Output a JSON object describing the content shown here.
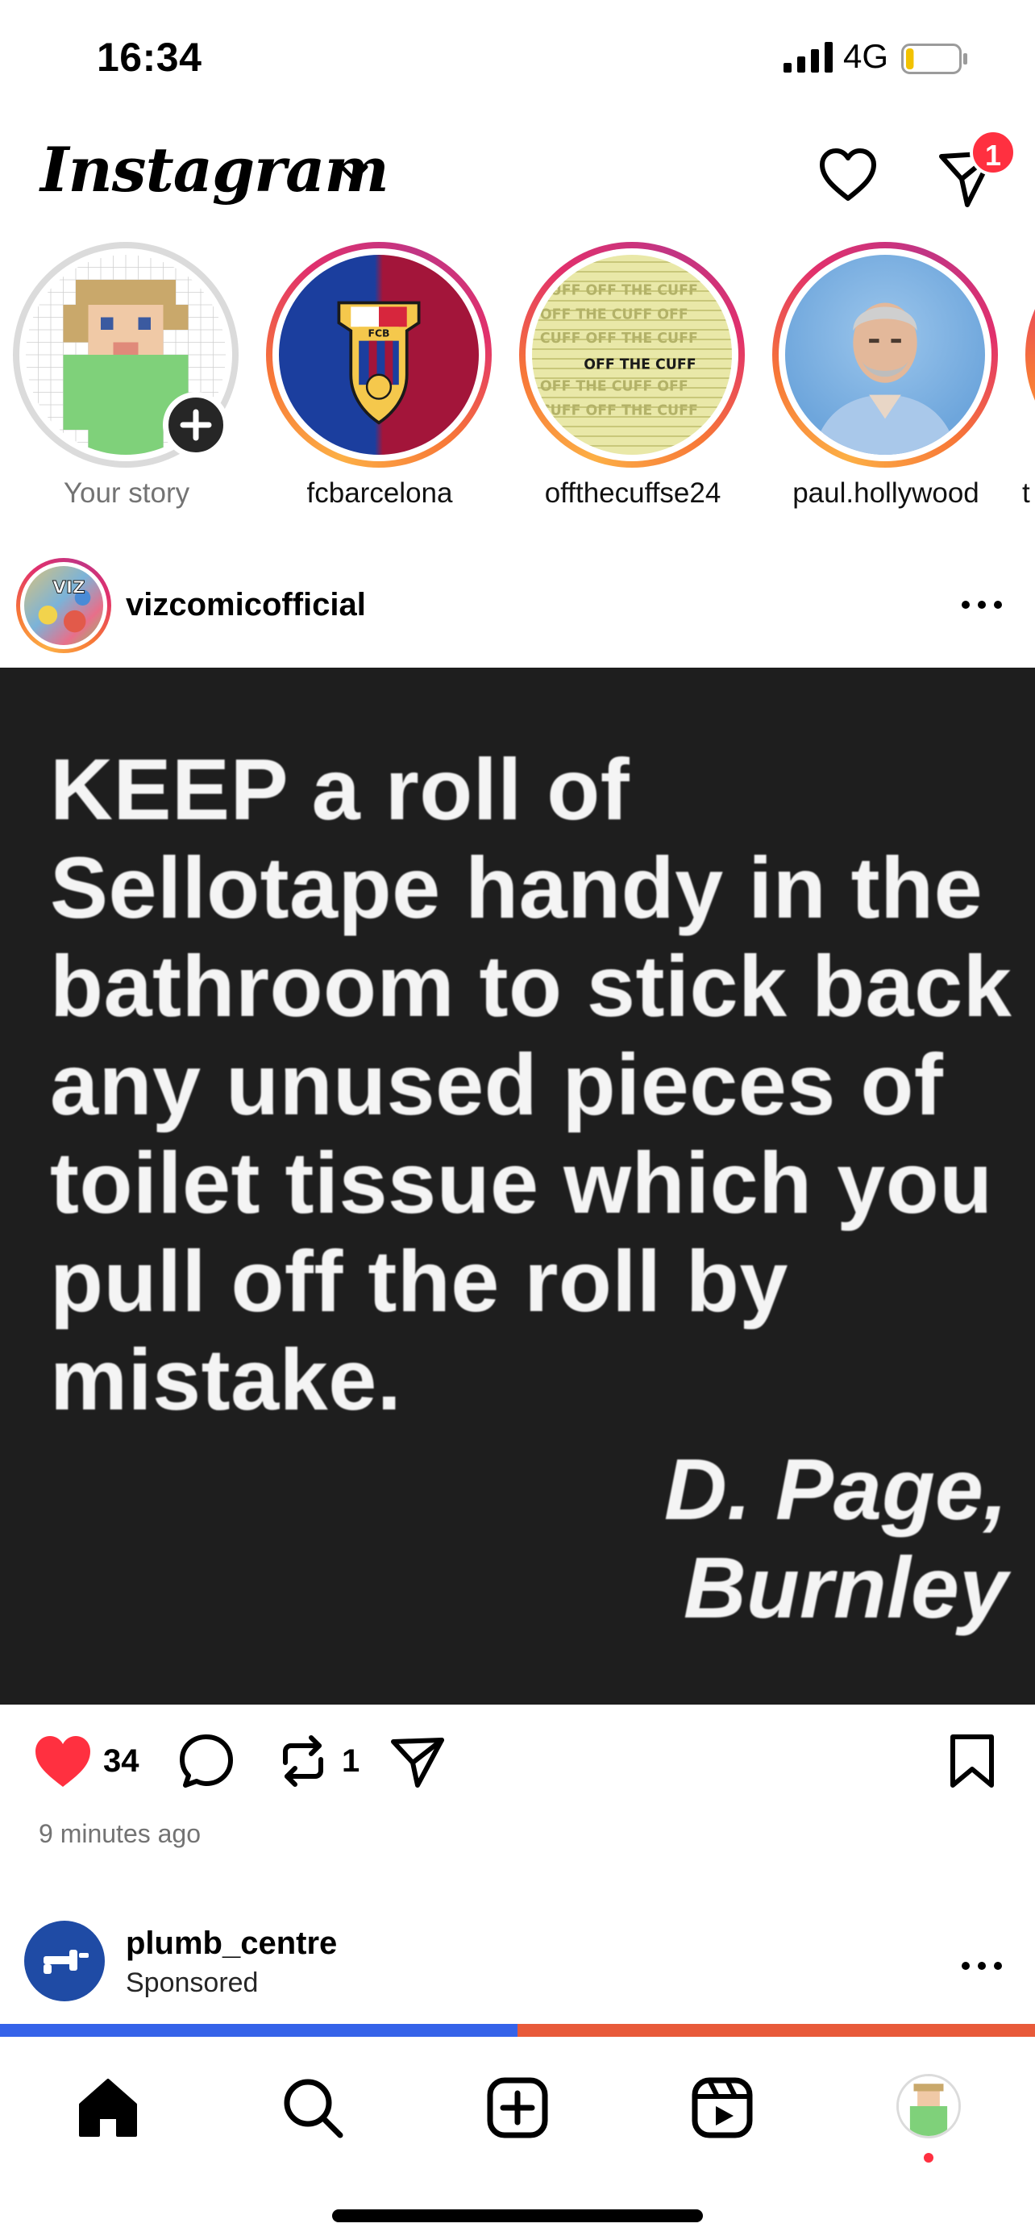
{
  "status_bar": {
    "time": "16:34",
    "network": "4G",
    "battery_level": 0.15
  },
  "header": {
    "title": "Instagram",
    "dm_badge": "1"
  },
  "stories": [
    {
      "label": "Your story",
      "kind": "self"
    },
    {
      "label": "fcbarcelona",
      "kind": "crest"
    },
    {
      "label": "offthecuffse24",
      "kind": "text",
      "avatar_text": "OFF THE CUFF"
    },
    {
      "label": "paul.hollywood",
      "kind": "person"
    },
    {
      "label": "t",
      "kind": "partial"
    }
  ],
  "post": {
    "username": "vizcomicofficial",
    "avatar_text": "VIZ",
    "quote": "KEEP a roll of Sellotape handy in the bathroom to stick back any unused pieces of toilet tissue which you pull off the roll by mistake.",
    "author_line1": "D. Page,",
    "author_line2": "Burnley",
    "likes": "34",
    "reposts": "1",
    "time_ago": "9 minutes ago"
  },
  "sponsored": {
    "username": "plumb_centre",
    "tag": "Sponsored",
    "progress": 0.5
  },
  "colors": {
    "like_red": "#ff3040",
    "progress_blue": "#3563e9",
    "progress_orange": "#e85a3a",
    "post_bg": "#1e1e1e"
  },
  "tab_bar": {
    "items": [
      "home-icon",
      "search-icon",
      "create-icon",
      "reels-icon",
      "profile-avatar"
    ]
  }
}
